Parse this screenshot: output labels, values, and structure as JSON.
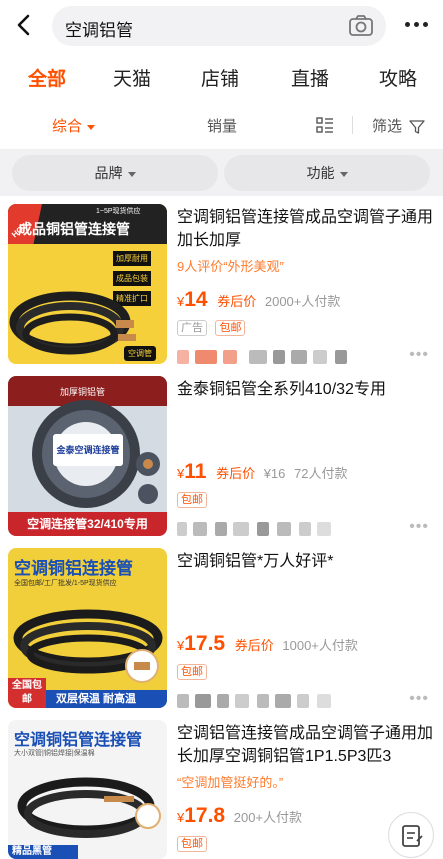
{
  "search": {
    "query": "空调铝管"
  },
  "tabs": [
    "全部",
    "天猫",
    "店铺",
    "直播",
    "攻略"
  ],
  "sort": {
    "comprehensive": "综合",
    "sales": "销量",
    "filter": "筛选"
  },
  "filters": {
    "brand": "品牌",
    "function": "功能"
  },
  "products": [
    {
      "title": "空调铜铝管连接管成品空调管子通用加长加厚",
      "review": "9人评价“外形美观”",
      "currency": "¥",
      "price": "14",
      "coupon": "券后价",
      "sales": "2000+人付款",
      "tags": [
        "广告",
        "包邮"
      ],
      "image": {
        "banner": "成品铜铝管连接管",
        "top_note": "1~5P现货供应",
        "badge": "HOT",
        "features": [
          "加厚耐用",
          "成品包装",
          "精准扩口"
        ],
        "corner": "空调管"
      }
    },
    {
      "title": "金泰铜铝管全系列410/32专用",
      "review": "",
      "currency": "¥",
      "price": "11",
      "coupon": "券后价",
      "original": "¥16",
      "sales": "72人付款",
      "tags": [
        "包邮"
      ],
      "image": {
        "banner": "空调连接管32/410专用",
        "label": "金泰空调连接管",
        "top_note": "加厚铜铝管"
      }
    },
    {
      "title": "空调铜铝管*万人好评*",
      "review": "",
      "currency": "¥",
      "price": "17.5",
      "coupon": "券后价",
      "sales": "1000+人付款",
      "tags": [
        "包邮"
      ],
      "image": {
        "banner": "空调铜铝连接管",
        "sub": "全国包邮/工厂批发/1-5P现货供应",
        "corner": "全国包邮",
        "bottom": "双层保温 耐高温"
      }
    },
    {
      "title": "空调铝管连接管成品空调管子通用加长加厚空调铜铝管1P1.5P3匹3",
      "review": "“空调加管挺好的。”",
      "currency": "¥",
      "price": "17.8",
      "coupon": "",
      "sales": "200+人付款",
      "tags": [
        "包邮"
      ],
      "image": {
        "banner": "空调铜铝管连接管",
        "sub": "大小双管|铜铝焊接|保温棉",
        "bottom": "精品黑管"
      }
    }
  ],
  "colors": {
    "accent": "#ff5000",
    "review": "#ff7a2c"
  },
  "icons": [
    "back-icon",
    "camera-icon",
    "more-icon",
    "list-view-icon",
    "filter-funnel-icon",
    "edit-note-icon"
  ]
}
